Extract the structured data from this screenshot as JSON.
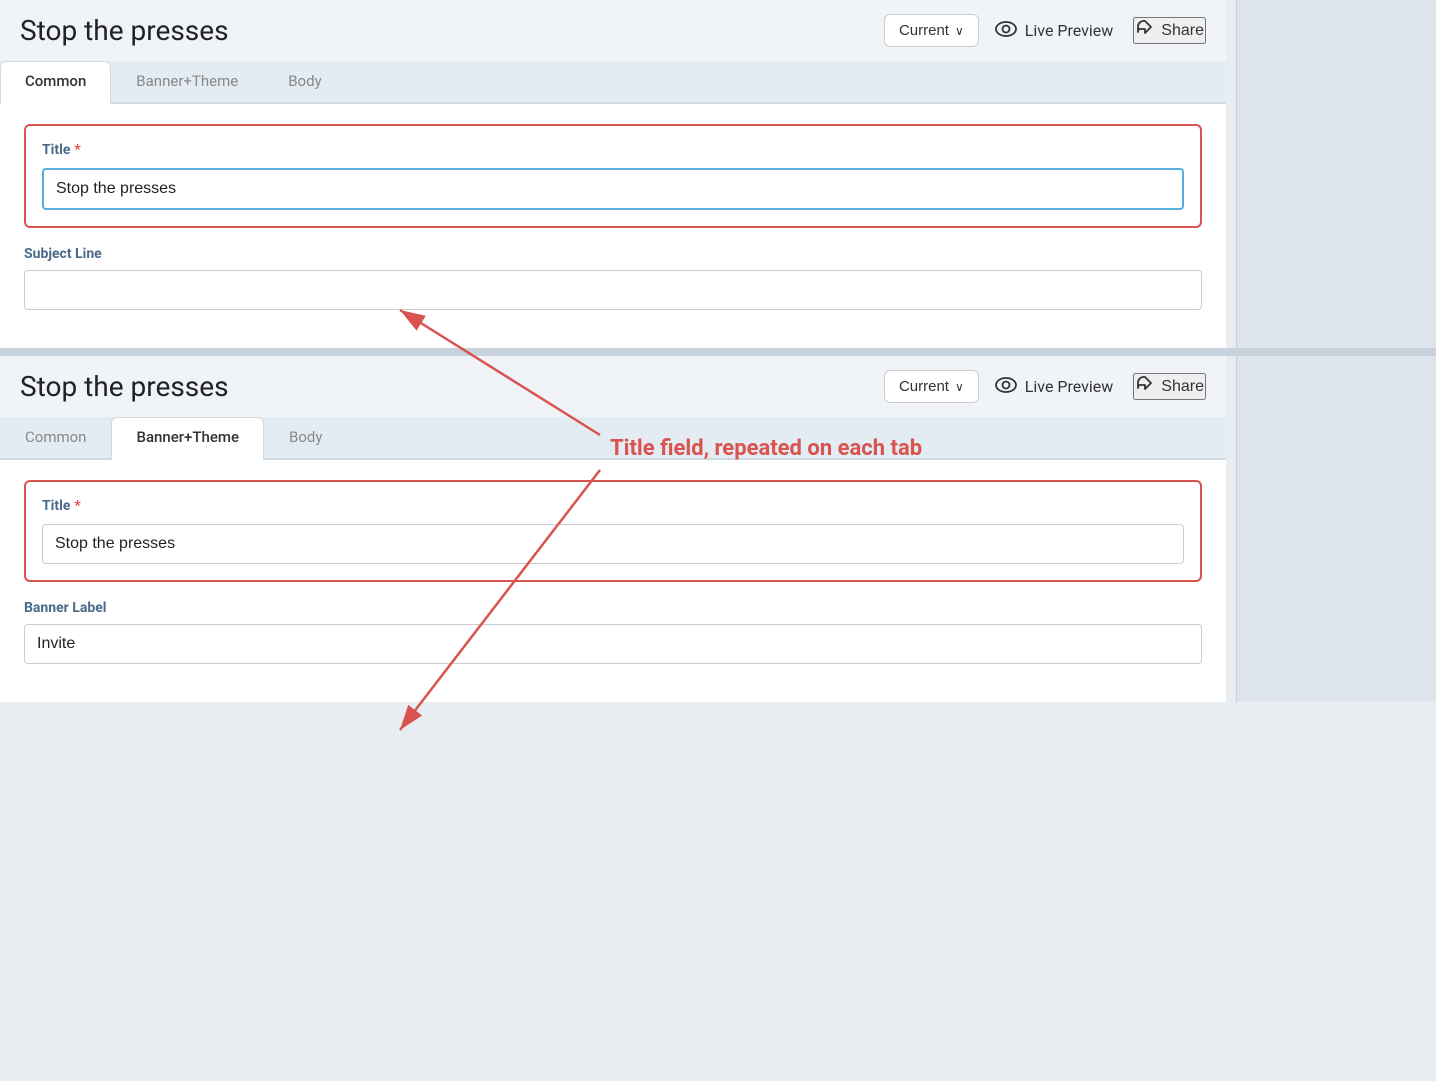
{
  "app": {
    "title": "Stop the presses"
  },
  "panel1": {
    "title": "Stop the presses",
    "dropdown_label": "Current",
    "live_preview_label": "Live Preview",
    "share_label": "Share",
    "tabs": [
      {
        "id": "common",
        "label": "Common",
        "active": true
      },
      {
        "id": "banner-theme",
        "label": "Banner+Theme",
        "active": false
      },
      {
        "id": "body",
        "label": "Body",
        "active": false
      }
    ],
    "title_field": {
      "label": "Title",
      "value": "Stop the presses",
      "required": true
    },
    "subject_field": {
      "label": "Subject Line",
      "value": "",
      "placeholder": ""
    }
  },
  "panel2": {
    "title": "Stop the presses",
    "dropdown_label": "Current",
    "live_preview_label": "Live Preview",
    "share_label": "Share",
    "tabs": [
      {
        "id": "common",
        "label": "Common",
        "active": false
      },
      {
        "id": "banner-theme",
        "label": "Banner+Theme",
        "active": true
      },
      {
        "id": "body",
        "label": "Body",
        "active": false
      }
    ],
    "title_field": {
      "label": "Title",
      "value": "Stop the presses",
      "required": true
    },
    "banner_label_field": {
      "label": "Banner Label",
      "value": "Invite"
    }
  },
  "annotation": {
    "text": "Title field, repeated on each tab"
  },
  "icons": {
    "eye": "eye",
    "share": "share",
    "chevron": "chevron-down"
  }
}
